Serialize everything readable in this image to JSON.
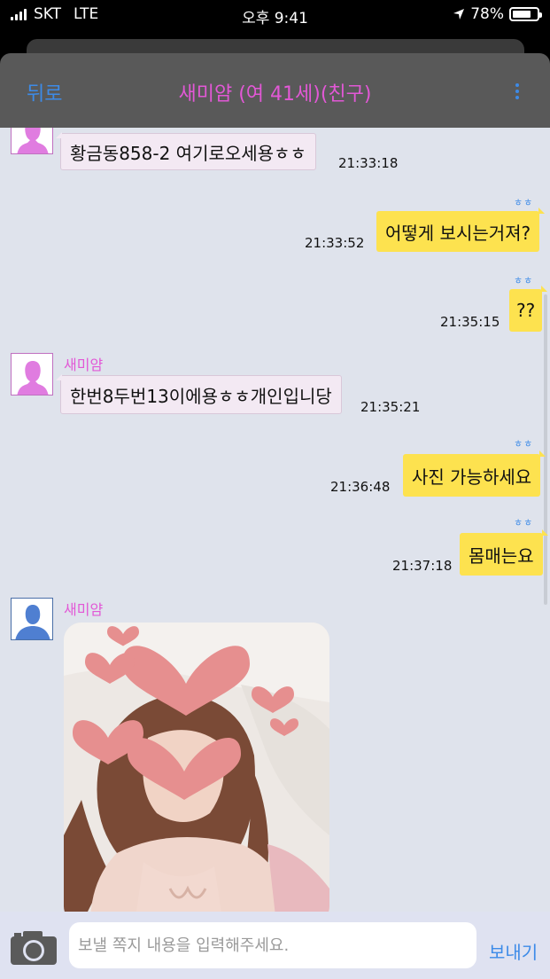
{
  "status_bar": {
    "carrier": "SKT",
    "network": "LTE",
    "time": "오후 9:41",
    "battery": "78%",
    "battery_level": 0.78
  },
  "header": {
    "back_label": "뒤로",
    "title": "새미얌 (여 41세)(친구)"
  },
  "messages": [
    {
      "direction": "in",
      "text": "황금동858-2 여기로오세용ㅎㅎ",
      "time": "21:33:18"
    },
    {
      "direction": "out",
      "read_mark": "ㅎㅎ",
      "text": "어떻게 보시는거져?",
      "time": "21:33:52"
    },
    {
      "direction": "out",
      "read_mark": "ㅎㅎ",
      "text": "??",
      "time": "21:35:15"
    },
    {
      "direction": "in",
      "sender": "새미얌",
      "text": "한번8두번13이에용ㅎㅎ개인입니당",
      "time": "21:35:21"
    },
    {
      "direction": "out",
      "read_mark": "ㅎㅎ",
      "text": "사진 가능하세요",
      "time": "21:36:48"
    },
    {
      "direction": "out",
      "read_mark": "ㅎㅎ",
      "text": "몸매는요",
      "time": "21:37:18"
    },
    {
      "direction": "in",
      "sender": "새미얌",
      "type": "image"
    }
  ],
  "input_bar": {
    "placeholder": "보낼 쪽지 내용을 입력해주세요.",
    "value": "",
    "send_label": "보내기"
  },
  "colors": {
    "accent_blue": "#3d8be8",
    "name_pink": "#e258d6",
    "outgoing_bubble": "#fde24f",
    "incoming_bubble": "#f3e9f3",
    "chat_background": "#dfe3ec"
  }
}
